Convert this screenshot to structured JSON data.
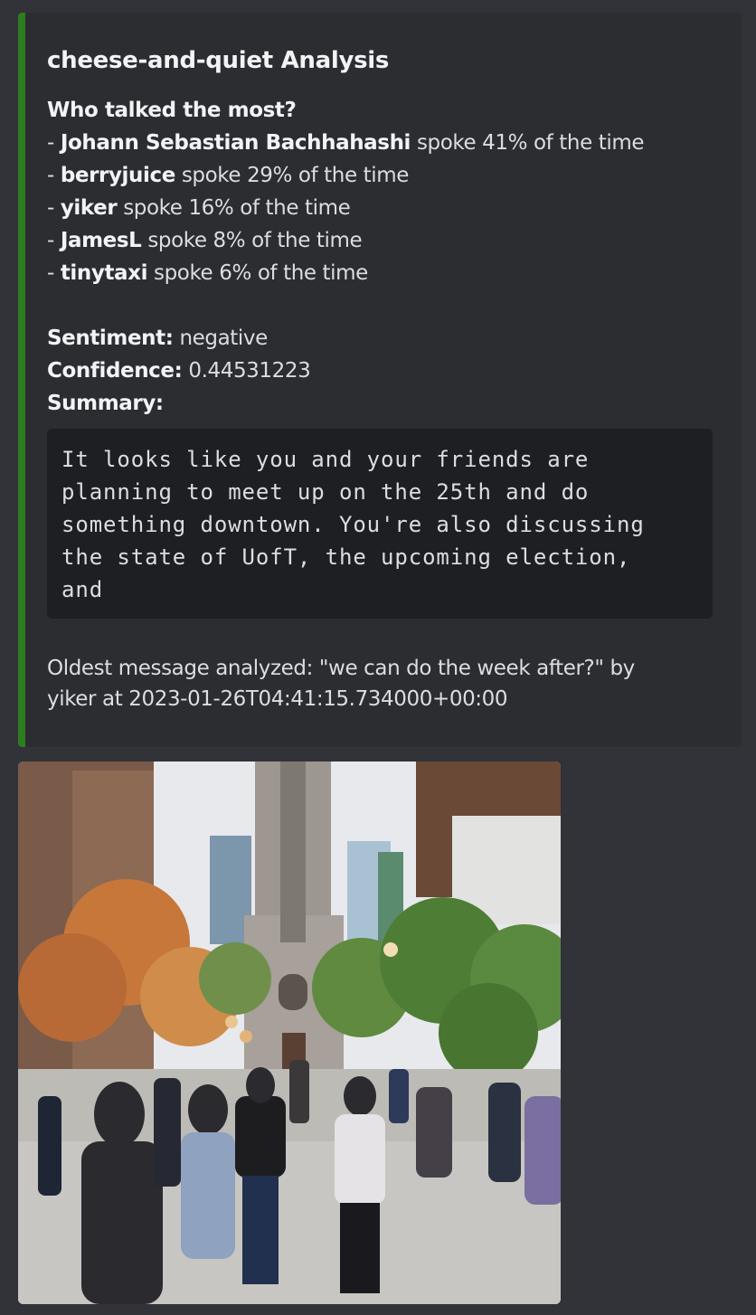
{
  "embed": {
    "accent_color": "#2d7d1e",
    "title": "cheese-and-quiet Analysis",
    "who_heading": "Who talked the most?",
    "speakers": [
      {
        "prefix": "- ",
        "name": "Johann Sebastian Bachhahashi",
        "text": " spoke 41% of the time"
      },
      {
        "prefix": "- ",
        "name": "berryjuice",
        "text": " spoke 29% of the time"
      },
      {
        "prefix": "- ",
        "name": "yiker",
        "text": " spoke 16% of the time"
      },
      {
        "prefix": "- ",
        "name": "JamesL",
        "text": " spoke 8% of the time"
      },
      {
        "prefix": "- ",
        "name": "tinytaxi",
        "text": " spoke 6% of the time"
      }
    ],
    "sentiment_label": "Sentiment:",
    "sentiment_value": " negative",
    "confidence_label": "Confidence:",
    "confidence_value": " 0.44531223",
    "summary_label": "Summary:",
    "summary_lines": [
      "It looks like you and your friends are",
      "planning to meet up on the 25th and do",
      "something downtown. You're also discussing",
      "the state of UofT, the upcoming election,",
      "and"
    ],
    "oldest_line1": "Oldest message analyzed: \"we can do the week after?\" by",
    "oldest_line2": "yiker at 2023-01-26T04:41:15.734000+00:00"
  },
  "image": {
    "description_icon": "photo-of-people-in-campus-plaza"
  }
}
